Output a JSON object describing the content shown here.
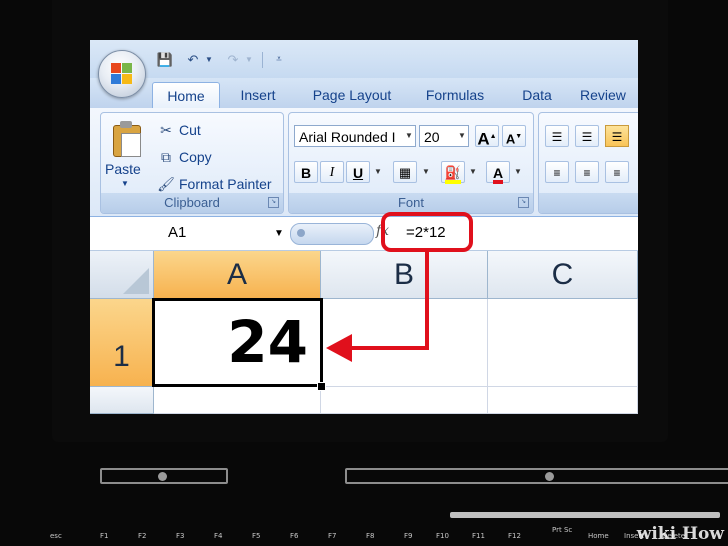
{
  "qat": {
    "icons": [
      "save-icon",
      "undo-icon",
      "redo-icon",
      "customize-icon"
    ]
  },
  "tabs": [
    {
      "label": "Home",
      "active": true
    },
    {
      "label": "Insert"
    },
    {
      "label": "Page Layout"
    },
    {
      "label": "Formulas"
    },
    {
      "label": "Data"
    },
    {
      "label": "Review"
    }
  ],
  "clipboard": {
    "paste": "Paste",
    "cut": "Cut",
    "copy": "Copy",
    "format_painter": "Format Painter",
    "group_label": "Clipboard"
  },
  "font": {
    "name": "Arial Rounded I",
    "size": "20",
    "group_label": "Font",
    "bold": "B",
    "italic": "I",
    "underline": "U",
    "grow": "A",
    "shrink": "A",
    "font_color_letter": "A"
  },
  "formula_bar": {
    "name_box": "A1",
    "fx": "fx",
    "formula": "=2*12"
  },
  "grid": {
    "columns": [
      "A",
      "B",
      "C"
    ],
    "rows": [
      "1"
    ],
    "cell_a1": "24"
  },
  "keyboard": {
    "keys": [
      "esc",
      "F1",
      "F2",
      "F3",
      "F4",
      "F5",
      "F6",
      "F7",
      "F8",
      "F9",
      "F10",
      "F11",
      "F12",
      "Prt Sc",
      "Home",
      "Insert",
      "Delete"
    ]
  },
  "watermark": "wiki How",
  "colors": {
    "highlight": "#e0101c",
    "selected_header": "#f7b24f",
    "ribbon_text": "#15428b"
  }
}
